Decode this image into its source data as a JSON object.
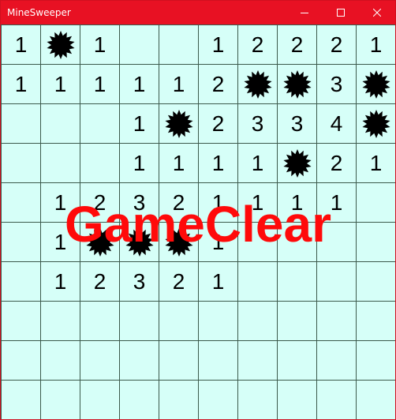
{
  "window": {
    "title": "MineSweeper",
    "accent_color": "#e81123",
    "board_color": "#d6fff8",
    "controls": {
      "minimize_icon": "minimize-icon",
      "maximize_icon": "maximize-icon",
      "close_icon": "close-icon"
    }
  },
  "board": {
    "rows": 10,
    "cols": 10,
    "cells": [
      [
        "1",
        "*",
        "1",
        "",
        "",
        "1",
        "2",
        "2",
        "2",
        "1"
      ],
      [
        "1",
        "1",
        "1",
        "1",
        "1",
        "2",
        "*",
        "*",
        "3",
        "*"
      ],
      [
        "",
        "",
        "",
        "1",
        "*",
        "2",
        "3",
        "3",
        "4",
        "*"
      ],
      [
        "",
        "",
        "",
        "1",
        "1",
        "1",
        "1",
        "*",
        "2",
        "1"
      ],
      [
        "",
        "1",
        "2",
        "3",
        "2",
        "1",
        "1",
        "1",
        "1",
        ""
      ],
      [
        "",
        "1",
        "*",
        "*",
        "*",
        "1",
        "",
        "",
        "",
        ""
      ],
      [
        "",
        "1",
        "2",
        "3",
        "2",
        "1",
        "",
        "",
        "",
        ""
      ],
      [
        "",
        "",
        "",
        "",
        "",
        "",
        "",
        "",
        "",
        ""
      ],
      [
        "",
        "",
        "",
        "",
        "",
        "",
        "",
        "",
        "",
        ""
      ],
      [
        "",
        "",
        "",
        "",
        "",
        "",
        "",
        "",
        "",
        ""
      ]
    ],
    "mine_symbol": "*",
    "mine_icon": "mine-icon"
  },
  "status": {
    "message": "GameClear",
    "color": "#ff0a0a"
  }
}
